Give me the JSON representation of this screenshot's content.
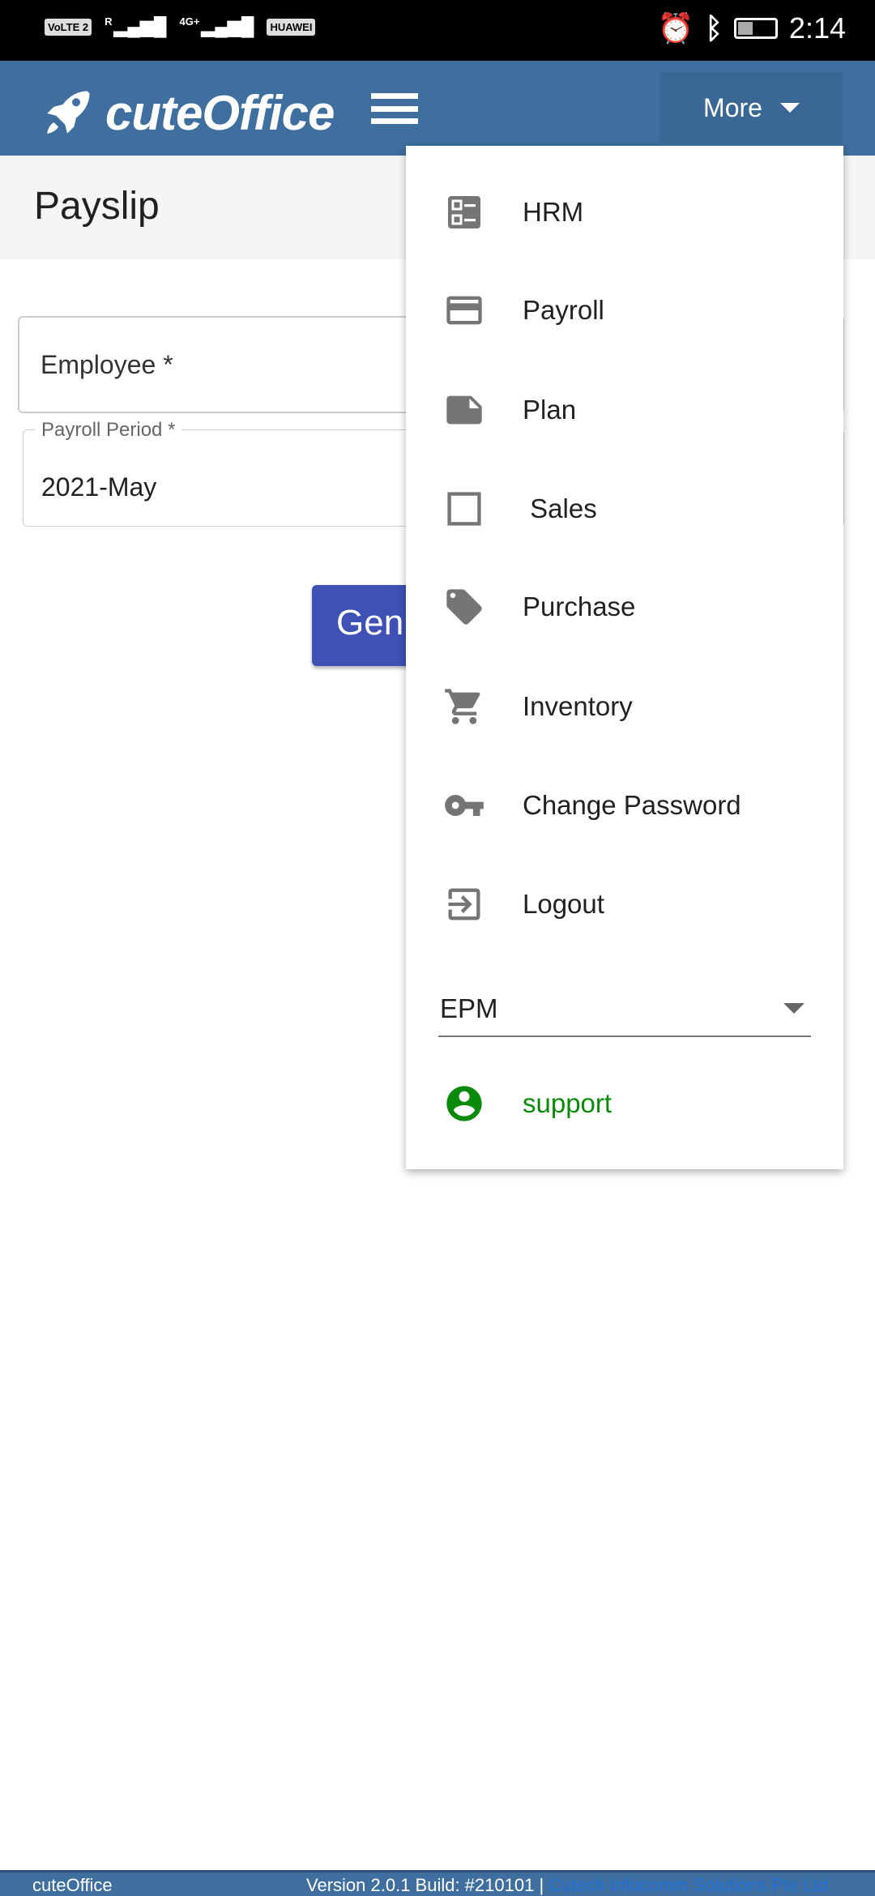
{
  "status_bar": {
    "left_badges": [
      "VoLTE 2",
      "R",
      "4G+",
      "HUAWEI"
    ],
    "time": "2:14"
  },
  "header": {
    "app_name": "cuteOffice",
    "more_label": "More"
  },
  "page": {
    "title": "Payslip"
  },
  "form": {
    "employee_label": "Employee *",
    "payroll_period_label": "Payroll Period *",
    "payroll_period_value": "2021-May",
    "generate_label": "Gen"
  },
  "menu": {
    "items": [
      {
        "label": "HRM",
        "icon": "list-icon"
      },
      {
        "label": "Payroll",
        "icon": "credit-card-icon"
      },
      {
        "label": "Plan",
        "icon": "note-icon"
      },
      {
        "label": " Sales",
        "icon": "square-icon"
      },
      {
        "label": "Purchase",
        "icon": "tag-icon"
      },
      {
        "label": "Inventory",
        "icon": "cart-icon"
      },
      {
        "label": "Change Password",
        "icon": "key-icon"
      },
      {
        "label": "Logout",
        "icon": "logout-icon"
      }
    ],
    "company_select": "EPM",
    "user": "support",
    "user_color": "#0a8a0a"
  },
  "footer": {
    "app": "cuteOffice",
    "version": "Version 2.0.1 Build: #210101 | ",
    "company": "Cutech Infocomm Solutions Pte Ltd"
  }
}
